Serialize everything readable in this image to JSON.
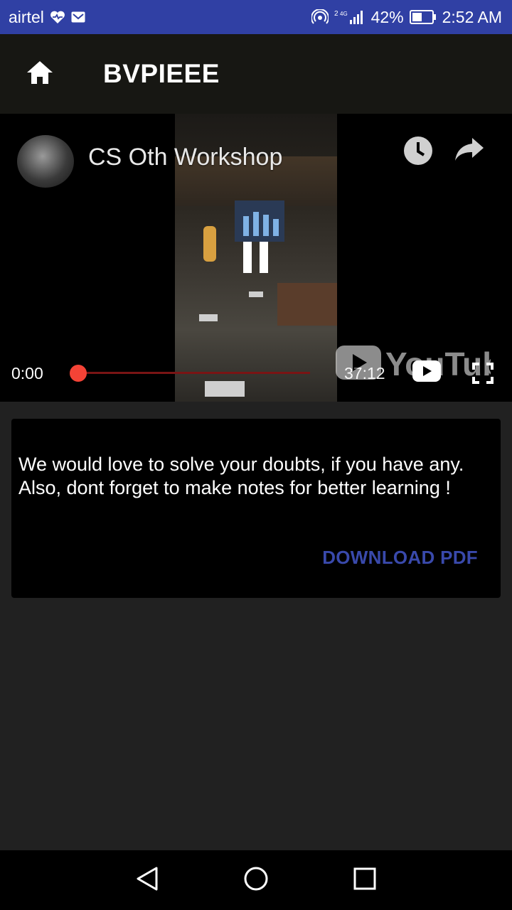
{
  "status_bar": {
    "carrier": "airtel",
    "network_label_top": "2",
    "network_label_type": "4G",
    "battery": "42%",
    "time": "2:52 AM"
  },
  "app_bar": {
    "title": "BVPIEEE",
    "home_icon": "home-icon"
  },
  "player": {
    "video_title": "CS Oth Workshop",
    "time_current": "0:00",
    "time_total": "37:12",
    "progress_fraction": 0,
    "logo_text": "YouTube"
  },
  "card": {
    "message": "We would love to solve your doubts, if you have any. Also, dont forget to make notes for better learning !",
    "download_label": "DOWNLOAD PDF"
  },
  "colors": {
    "status_bar": "#3040a4",
    "app_bar": "#171713",
    "background": "#212121",
    "accent": "#3949ab",
    "progress_knob": "#f44336"
  }
}
